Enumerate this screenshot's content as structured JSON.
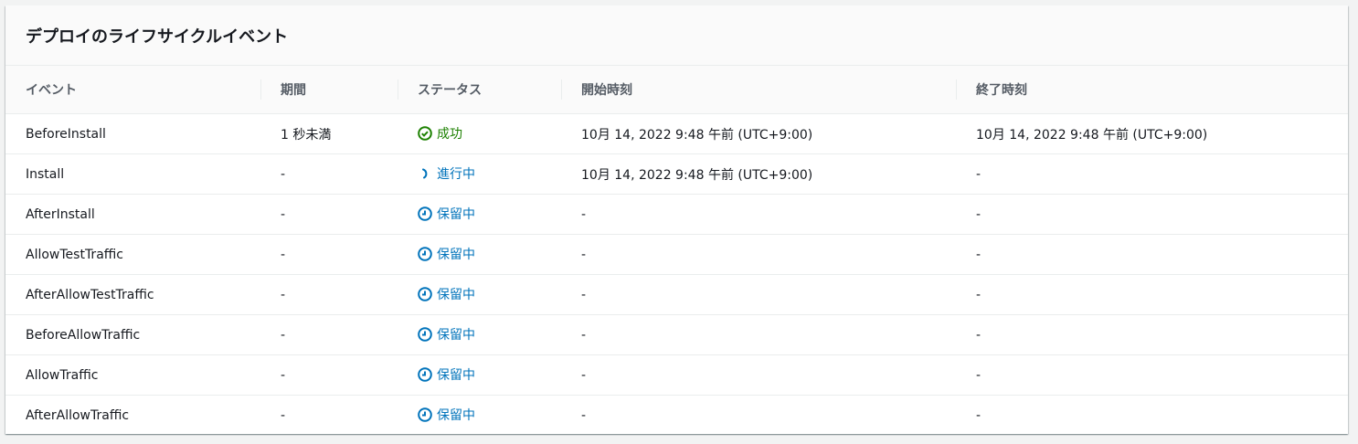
{
  "title": "デプロイのライフサイクルイベント",
  "columns": [
    "イベント",
    "期間",
    "ステータス",
    "開始時刻",
    "終了時刻"
  ],
  "colors": {
    "success": "#1d8102",
    "info": "#0073bb"
  },
  "rows": [
    {
      "event": "BeforeInstall",
      "duration": "1 秒未満",
      "status": "成功",
      "status_type": "success",
      "status_icon": "check-circle-icon",
      "start": "10月 14, 2022 9:48 午前 (UTC+9:00)",
      "end": "10月 14, 2022 9:48 午前 (UTC+9:00)"
    },
    {
      "event": "Install",
      "duration": "-",
      "status": "進行中",
      "status_type": "in-progress",
      "status_icon": "spinner-icon",
      "start": "10月 14, 2022 9:48 午前 (UTC+9:00)",
      "end": "-"
    },
    {
      "event": "AfterInstall",
      "duration": "-",
      "status": "保留中",
      "status_type": "pending",
      "status_icon": "clock-icon",
      "start": "-",
      "end": "-"
    },
    {
      "event": "AllowTestTraffic",
      "duration": "-",
      "status": "保留中",
      "status_type": "pending",
      "status_icon": "clock-icon",
      "start": "-",
      "end": "-"
    },
    {
      "event": "AfterAllowTestTraffic",
      "duration": "-",
      "status": "保留中",
      "status_type": "pending",
      "status_icon": "clock-icon",
      "start": "-",
      "end": "-"
    },
    {
      "event": "BeforeAllowTraffic",
      "duration": "-",
      "status": "保留中",
      "status_type": "pending",
      "status_icon": "clock-icon",
      "start": "-",
      "end": "-"
    },
    {
      "event": "AllowTraffic",
      "duration": "-",
      "status": "保留中",
      "status_type": "pending",
      "status_icon": "clock-icon",
      "start": "-",
      "end": "-"
    },
    {
      "event": "AfterAllowTraffic",
      "duration": "-",
      "status": "保留中",
      "status_type": "pending",
      "status_icon": "clock-icon",
      "start": "-",
      "end": "-"
    }
  ]
}
